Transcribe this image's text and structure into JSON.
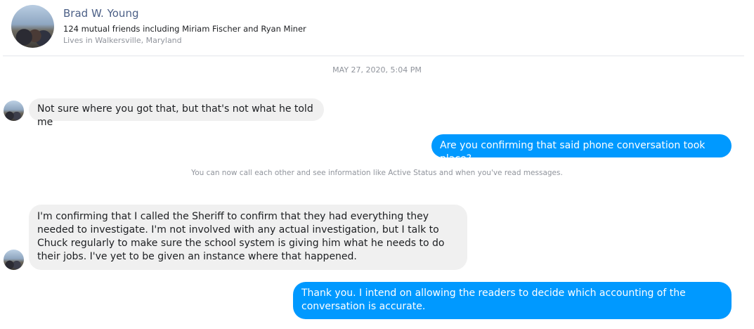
{
  "contact": {
    "name": "Brad W. Young",
    "mutual_friends": "124 mutual friends including Miriam Fischer and Ryan Miner",
    "location": "Lives in Walkersville, Maryland"
  },
  "conversation": {
    "timestamp": "MAY 27, 2020, 5:04 PM",
    "notice": "You can now call each other and see information like Active Status and when you've read messages.",
    "messages": [
      {
        "direction": "incoming",
        "text": "Not sure where you got that, but that's not what he told me"
      },
      {
        "direction": "outgoing",
        "text": "Are you confirming that said phone conversation took place?"
      },
      {
        "direction": "incoming",
        "text": "I'm confirming that I called the Sheriff to confirm that they had everything they needed to investigate. I'm not involved with any actual investigation, but I talk to Chuck regularly to make sure the school system is giving him what he needs to do their jobs. I've yet to be given an instance where that happened."
      },
      {
        "direction": "outgoing",
        "text": "Thank you. I intend on allowing the readers to decide which accounting of the conversation is accurate."
      }
    ]
  },
  "colors": {
    "outgoing_bubble": "#0099ff",
    "incoming_bubble": "#f0f0f0",
    "name_link": "#4b5f86",
    "muted_text": "#90949c"
  }
}
